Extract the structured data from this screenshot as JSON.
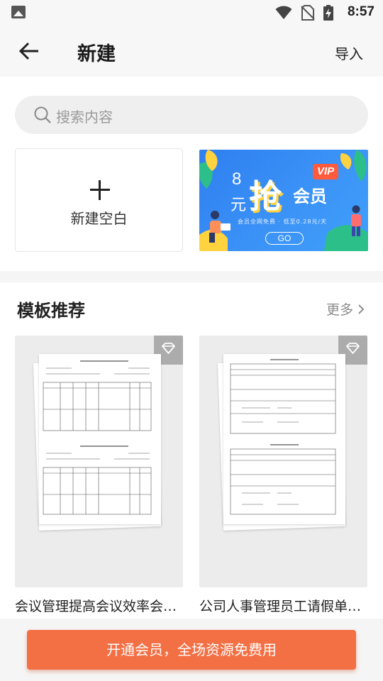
{
  "status_bar": {
    "time": "8:57"
  },
  "header": {
    "title": "新建",
    "import_label": "导入"
  },
  "search": {
    "placeholder": "搜索内容"
  },
  "blank_card": {
    "label": "新建空白"
  },
  "vip_banner": {
    "price": "8",
    "unit": "元",
    "big_char": "抢",
    "member": "会员",
    "badge": "VIP",
    "subtitle": "会员全网免费 · 低至0.28元/天",
    "cta": "GO"
  },
  "templates": {
    "section_title": "模板推荐",
    "more_label": "更多",
    "items": [
      {
        "name": "会议管理提高会议效率会…"
      },
      {
        "name": "公司人事管理员工请假单…"
      }
    ]
  },
  "bottom": {
    "cta_label": "开通会员，全场资源免费用"
  },
  "colors": {
    "accent": "#f36f44",
    "banner_blue": "#3c94f7",
    "vip_yellow": "#ffd23f"
  }
}
